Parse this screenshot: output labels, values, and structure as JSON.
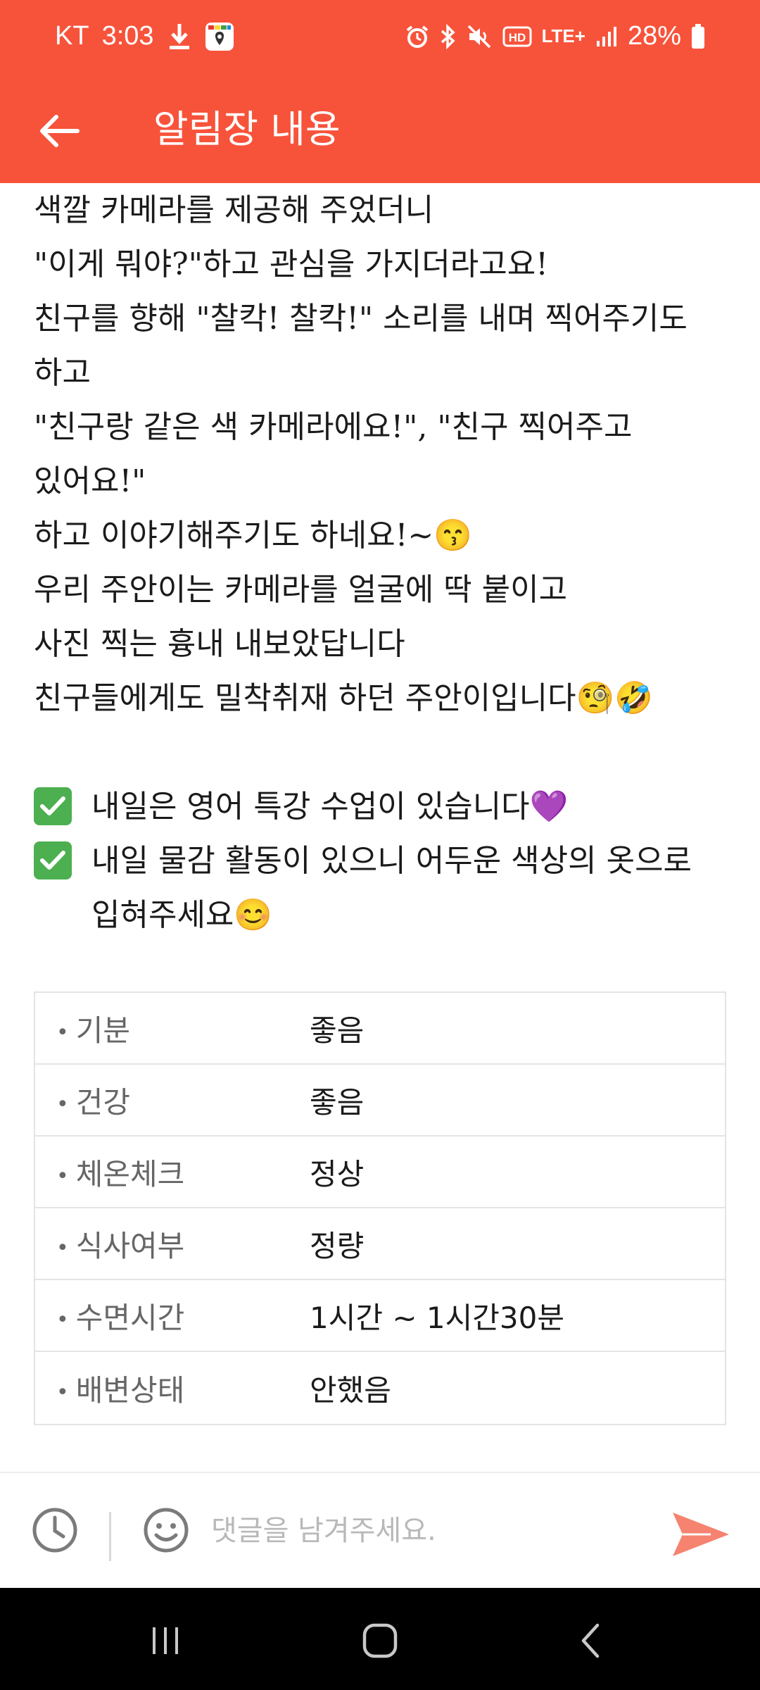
{
  "status_bar": {
    "carrier": "KT",
    "time": "3:03",
    "network": "LTE+",
    "battery": "28%"
  },
  "header": {
    "title": "알림장 내용"
  },
  "body": {
    "lines": [
      "색깔 카메라를 제공해 주었더니",
      "\"이게 뭐야?\"하고 관심을 가지더라고요!",
      "친구를 향해 \"찰칵! 찰칵!\" 소리를 내며 찍어주기도",
      "하고",
      "\"친구랑 같은 색 카메라에요!\", \"친구 찍어주고",
      "있어요!\"",
      "하고 이야기해주기도 하네요!~😙",
      "우리 주안이는 카메라를 얼굴에 딱 붙이고",
      "사진 찍는 흉내 내보았답니다",
      "친구들에게도 밀착취재 하던 주안이입니다🧐🤣"
    ],
    "checklist": [
      "내일은 영어 특강 수업이 있습니다💜",
      "내일 물감 활동이 있으니 어두운 색상의 옷으로 입혀주세요😊"
    ]
  },
  "status_table": {
    "rows": [
      {
        "label": "기분",
        "value": "좋음"
      },
      {
        "label": "건강",
        "value": "좋음"
      },
      {
        "label": "체온체크",
        "value": "정상"
      },
      {
        "label": "식사여부",
        "value": "정량"
      },
      {
        "label": "수면시간",
        "value": "1시간 ~ 1시간30분"
      },
      {
        "label": "배변상태",
        "value": "안했음"
      }
    ]
  },
  "comment": {
    "placeholder": "댓글을 남겨주세요."
  },
  "colors": {
    "primary": "#f7533b",
    "send": "#f5836f",
    "check": "#4caf50"
  }
}
